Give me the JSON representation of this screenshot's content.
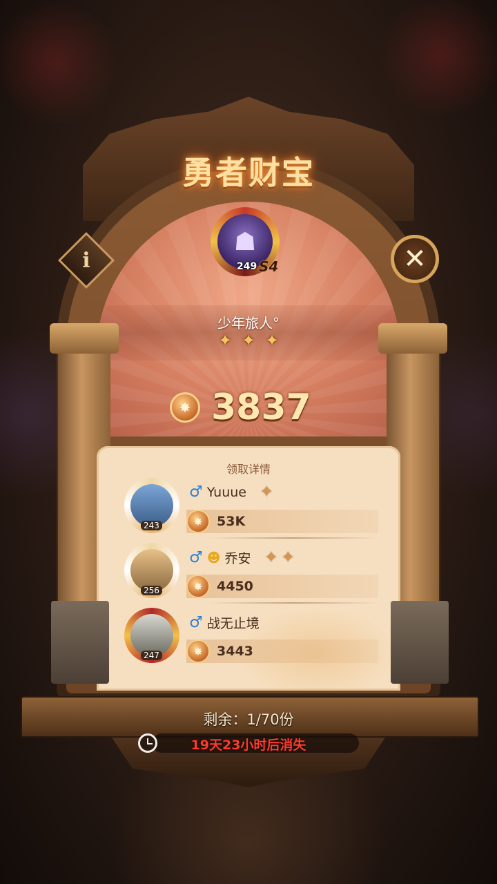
{
  "dialog": {
    "title": "勇者财宝",
    "info_icon": "i",
    "close_icon": "✕"
  },
  "owner": {
    "level": "249",
    "season": "S4",
    "name": "少年旅人°",
    "badges": [
      "✦",
      "✦",
      "✦"
    ]
  },
  "treasure": {
    "coin_icon": "coin-icon",
    "total": "3837"
  },
  "list": {
    "header": "领取详情",
    "rows": [
      {
        "level": "243",
        "name": "Yuuue",
        "prefix": "",
        "amount": "53K",
        "badges": [
          "✦"
        ]
      },
      {
        "level": "256",
        "name": "乔安",
        "prefix": "☻",
        "amount": "4450",
        "badges": [
          "✦",
          "✦"
        ]
      },
      {
        "level": "247",
        "name": "战无止境",
        "prefix": "",
        "amount": "3443",
        "badges": []
      }
    ]
  },
  "footer": {
    "remaining": "剩余：1/70份",
    "timer": "19天23小时后消失"
  },
  "colors": {
    "timer_text": "#ff3b2e",
    "title_glow": "#ff9a3a",
    "male_icon": "#2a7ed8"
  }
}
